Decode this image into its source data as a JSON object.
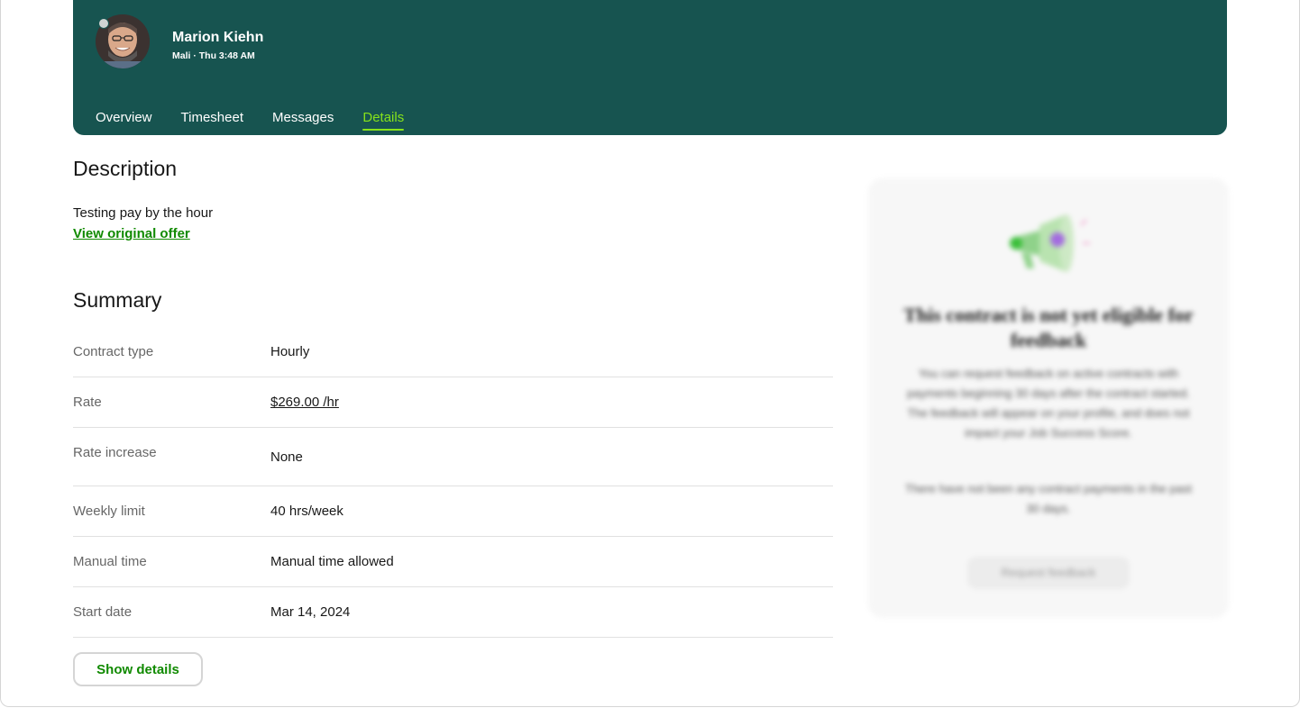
{
  "header": {
    "user": {
      "name": "Marion Kiehn",
      "meta": "Mali · Thu 3:48 AM"
    },
    "tabs": [
      {
        "label": "Overview",
        "active": false
      },
      {
        "label": "Timesheet",
        "active": false
      },
      {
        "label": "Messages",
        "active": false
      },
      {
        "label": "Details",
        "active": true
      }
    ]
  },
  "description": {
    "title": "Description",
    "text": "Testing pay by the hour",
    "link_label": "View original offer"
  },
  "summary": {
    "title": "Summary",
    "rows": [
      {
        "label": "Contract type",
        "value": "Hourly"
      },
      {
        "label": "Rate",
        "value": "$269.00 /hr"
      },
      {
        "label": "Rate increase",
        "value": "None"
      },
      {
        "label": "Weekly limit",
        "value": "40 hrs/week"
      },
      {
        "label": "Manual time",
        "value": "Manual time allowed"
      },
      {
        "label": "Start date",
        "value": "Mar 14, 2024"
      }
    ],
    "show_details_label": "Show details"
  },
  "feedback_card": {
    "title": "This contract is not yet eligible for feedback",
    "text1": "You can request feedback on active contracts with payments beginning 30 days after the contract started. The feedback will appear on your profile, and does not impact your Job Success Score.",
    "text2": "There have not been any contract payments in the past 30 days.",
    "button_label": "Request feedback"
  },
  "colors": {
    "header_bg": "#175450",
    "active_tab": "#86e21b",
    "link": "#108a00"
  }
}
